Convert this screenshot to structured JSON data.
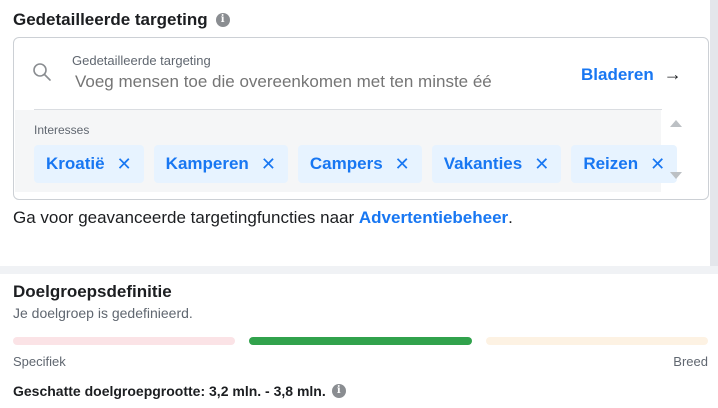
{
  "targeting": {
    "title": "Gedetailleerde targeting",
    "info_icon": "i",
    "search_label": "Gedetailleerde targeting",
    "search_placeholder": "Voeg mensen toe die overeenkomen met ten minste éé",
    "browse_label": "Bladeren",
    "browse_arrow": "→",
    "interests_label": "Interesses",
    "chips": [
      "Kroatië",
      "Kamperen",
      "Campers",
      "Vakanties",
      "Reizen"
    ],
    "chip_remove": "✕",
    "help_prefix": "Ga voor geavanceerde targetingfuncties naar ",
    "help_link": "Advertentiebeheer",
    "help_suffix": "."
  },
  "audience": {
    "title": "Doelgroepsdefinitie",
    "subtitle": "Je doelgroep is gedefinieerd.",
    "meter_left": "Specifiek",
    "meter_right": "Breed",
    "estimate": "Geschatte doelgroepgrootte: 3,2 mln. - 3,8 mln.",
    "info_icon": "i"
  },
  "colors": {
    "accent": "#1877f2",
    "chip_bg": "#e7f3ff",
    "meter_active": "#31a24c"
  }
}
